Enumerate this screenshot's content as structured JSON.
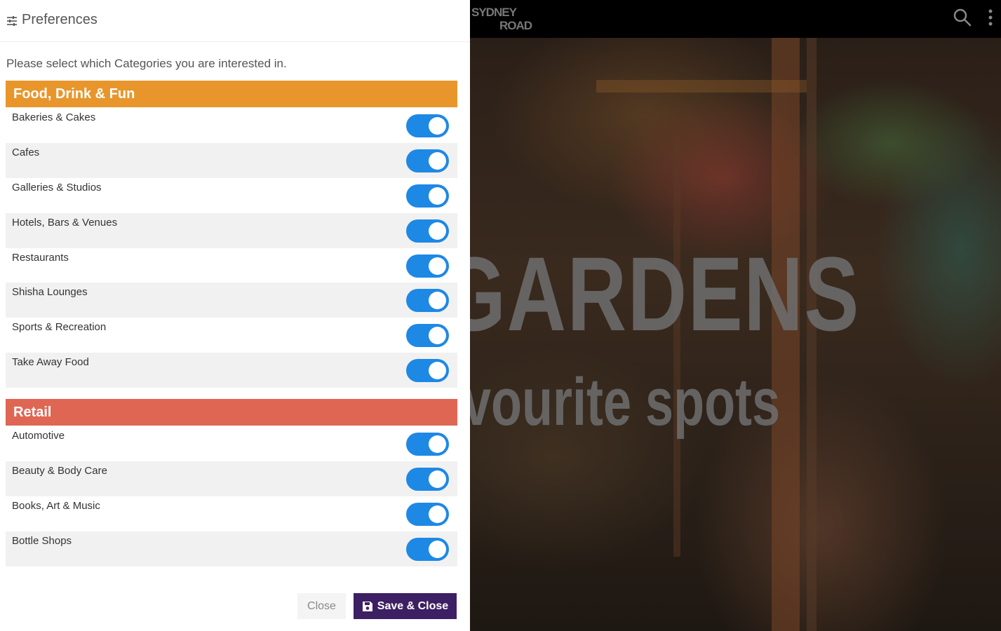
{
  "panel": {
    "title": "Preferences",
    "intro": "Please select which Categories you are interested in.",
    "sections": [
      {
        "name": "Food, Drink & Fun",
        "color": "#e8962b",
        "items": [
          {
            "label": "Bakeries & Cakes",
            "enabled": true
          },
          {
            "label": "Cafes",
            "enabled": true
          },
          {
            "label": "Galleries & Studios",
            "enabled": true
          },
          {
            "label": "Hotels, Bars & Venues",
            "enabled": true
          },
          {
            "label": "Restaurants",
            "enabled": true
          },
          {
            "label": "Shisha Lounges",
            "enabled": true
          },
          {
            "label": "Sports & Recreation",
            "enabled": true
          },
          {
            "label": "Take Away Food",
            "enabled": true
          }
        ]
      },
      {
        "name": "Retail",
        "color": "#e06654",
        "items": [
          {
            "label": "Automotive",
            "enabled": true
          },
          {
            "label": "Beauty & Body Care",
            "enabled": true
          },
          {
            "label": "Books, Art & Music",
            "enabled": true
          },
          {
            "label": "Bottle Shops",
            "enabled": true
          }
        ]
      }
    ],
    "buttons": {
      "close": "Close",
      "save": "Save & Close"
    }
  },
  "background": {
    "logo_line1": "SYDNEY",
    "logo_line2": "ROAD",
    "hero_title": "GARDENS",
    "hero_subtitle": "vourite spots"
  },
  "colors": {
    "toggle_on": "#1e88e5",
    "save_button": "#3d1f63"
  },
  "icons": [
    "sliders-icon",
    "search-icon",
    "more-vert-icon",
    "save-icon"
  ]
}
